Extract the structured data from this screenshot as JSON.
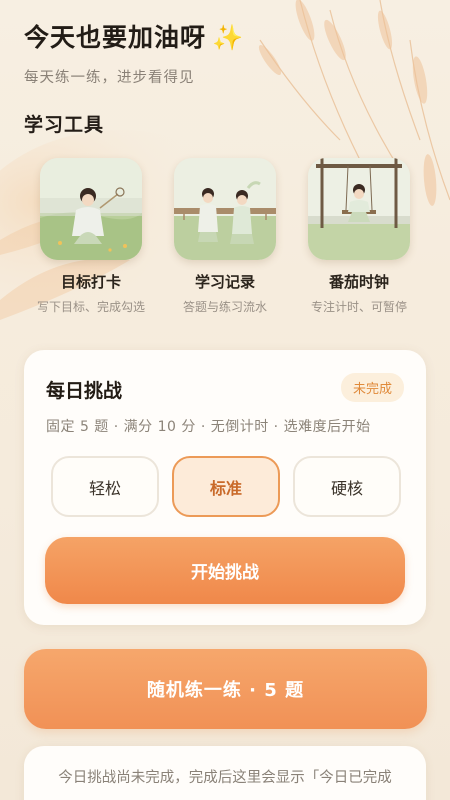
{
  "header": {
    "title": "今天也要加油呀",
    "sparkle": "✨",
    "subtitle": "每天练一练，进步看得见"
  },
  "tools_section": {
    "title": "学习工具",
    "items": [
      {
        "name": "目标打卡",
        "desc": "写下目标、完成勾选"
      },
      {
        "name": "学习记录",
        "desc": "答题与练习流水"
      },
      {
        "name": "番茄时钟",
        "desc": "专注计时、可暂停"
      }
    ]
  },
  "daily_challenge": {
    "title": "每日挑战",
    "status": "未完成",
    "info": "固定 5 题 · 满分 10 分 · 无倒计时 · 选难度后开始",
    "difficulties": [
      "轻松",
      "标准",
      "硬核"
    ],
    "selected": "标准",
    "start_label": "开始挑战"
  },
  "random_practice": {
    "label": "随机练一练 · 5 题"
  },
  "bottom_card": {
    "text": "今日挑战尚未完成，完成后这里会显示「今日已完成"
  },
  "colors": {
    "accent": "#f0884a",
    "badge_text": "#e08a3a",
    "background": "#f6ecdd"
  }
}
